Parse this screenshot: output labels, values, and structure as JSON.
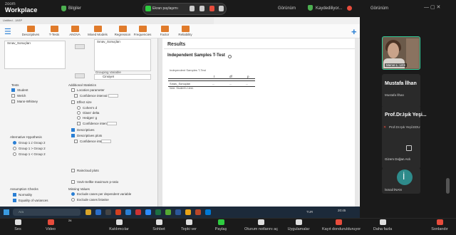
{
  "zoom_top": {
    "logo_line1": "zoom",
    "logo_line2": "Workplace",
    "info_label": "Bilgiler",
    "share_text": "Ekran paylaşımı",
    "view_label": "Görünüm",
    "recording_label": "Kaydediliyor...",
    "view_label2": "Görünüm"
  },
  "jasp": {
    "window_title": "Untitled - JASP",
    "tools": [
      "Descriptives",
      "T-Tests",
      "ANOVA",
      "Mixed Models",
      "Regression",
      "Frequencies",
      "Factor",
      "Reliability"
    ],
    "variable_item": "Sınav_Sonuçları",
    "dependent_item": "Sınav_Sonuçları",
    "grouping_label": "Grouping Variable",
    "grouping_item": "Cinsiyet",
    "tests_header": "Tests",
    "tests": [
      {
        "label": "Student",
        "checked": true
      },
      {
        "label": "Welch",
        "checked": false
      },
      {
        "label": "Mann-Whitney",
        "checked": false
      }
    ],
    "alt_header": "Alternative Hypothesis",
    "alternatives": [
      {
        "label": "Group 1 ≠ Group 2",
        "checked": true
      },
      {
        "label": "Group 1 > Group 2",
        "checked": false
      },
      {
        "label": "Group 1 < Group 2",
        "checked": false
      }
    ],
    "assump_header": "Assumption Checks",
    "assumptions": [
      {
        "label": "Normality",
        "checked": true
      },
      {
        "label": "Equality of variances",
        "checked": true
      }
    ],
    "add_header": "Additional Statistics",
    "additional": [
      {
        "label": "Location parameter",
        "checked": false
      },
      {
        "label": "Confidence interval",
        "checked": false
      },
      {
        "label": "Effect size",
        "checked": false
      },
      {
        "label": "Cohen's d",
        "checked": false
      },
      {
        "label": "Glass' delta",
        "checked": false
      },
      {
        "label": "Hedges' g",
        "checked": false
      },
      {
        "label": "Confidence interval",
        "checked": false
      },
      {
        "label": "Descriptives",
        "checked": true
      },
      {
        "label": "Descriptives plots",
        "checked": true
      },
      {
        "label": "Confidence interval",
        "checked": false
      },
      {
        "label": "Raincloud plots",
        "checked": false
      },
      {
        "label": "Vovk-Sellke maximum p-ratio",
        "checked": false
      }
    ],
    "ci_value": "95.0",
    "missing_header": "Missing Values",
    "missing": [
      {
        "label": "Exclude cases per dependent variable",
        "checked": true
      },
      {
        "label": "Exclude cases listwise",
        "checked": false
      }
    ],
    "results_title": "Results",
    "ttest_title": "Independent Samples T-Test",
    "ttest_label": "Independent Samples T-Test",
    "table_headers": [
      "",
      "t",
      "df",
      "p"
    ],
    "table_row": [
      "Sınav_Sonuçları",
      "...",
      "...",
      "..."
    ],
    "note": "Note. Student's t-test."
  },
  "taskbar": {
    "search_placeholder": "Ara",
    "tray_text": "TUR",
    "clock": "20:45"
  },
  "participants": [
    {
      "name": "Merve L. LES",
      "has_video": true
    },
    {
      "name": "Mustafa İlhan",
      "sub": "Mustafa İlhan"
    },
    {
      "name": "Prof.Dr.Işık Yeşi...",
      "sub": "Prof.Dr.Işık Yeşil.EDU"
    },
    {
      "name": "Gizem Doğan Aslı"
    },
    {
      "name": "İsmail İNAN",
      "initial": "İ"
    }
  ],
  "zoom_bottom": {
    "buttons": [
      "Ses",
      "Video",
      "Katılımcılar",
      "Sohbet",
      "Tepki ver",
      "Paylaş",
      "Oturum notlarını aç",
      "Uygulamalar",
      "Kayıt dondurulduruyor",
      "Daha fazla",
      "Sonlandır"
    ],
    "participant_count": "24"
  },
  "colors": {
    "jasp_accent": "#2a7fd4",
    "jasp_tool": "#e07b2b",
    "zoom_green": "#2ecc40",
    "end_red": "#e74c3c"
  }
}
